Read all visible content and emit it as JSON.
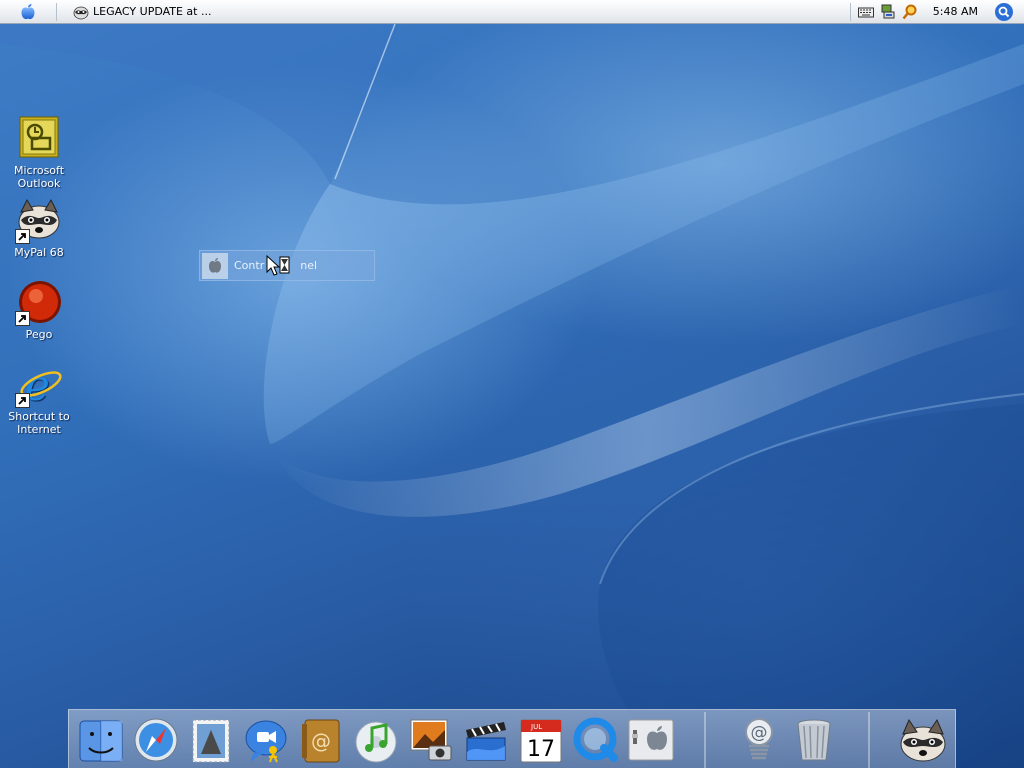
{
  "menubar": {
    "task_title": "LEGACY UPDATE at ...",
    "clock": "5:48 AM"
  },
  "desktop_icons": [
    {
      "label_line1": "Microsoft",
      "label_line2": "Outlook"
    },
    {
      "label_line1": "MyPal 68",
      "label_line2": ""
    },
    {
      "label_line1": "Pego",
      "label_line2": ""
    },
    {
      "label_line1": "Shortcut to",
      "label_line2": "Internet"
    }
  ],
  "drag_ghost": {
    "label_left": "Contr",
    "label_right": "nel"
  },
  "dock": {
    "calendar_month": "JUL",
    "calendar_day": "17"
  },
  "colors": {
    "desktop_blue": "#2f6db7",
    "menubar_bg": "#eceff3"
  }
}
